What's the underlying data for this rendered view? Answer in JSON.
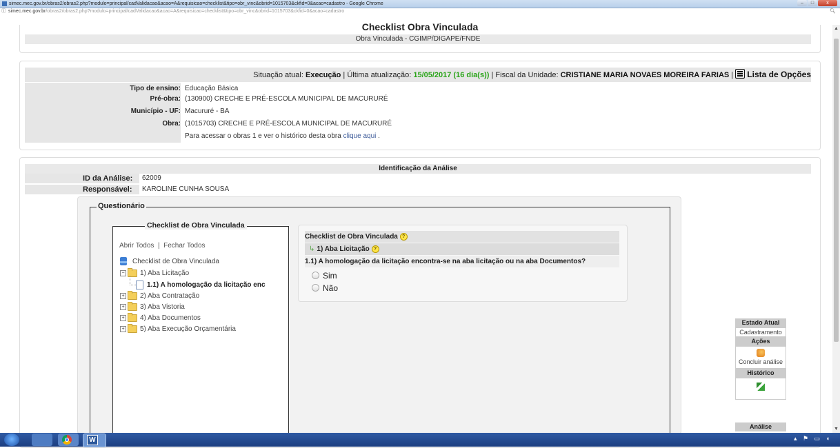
{
  "browser": {
    "title": "simec.mec.gov.br/obras2/obras2.php?modulo=principal/cadValidacao&acao=A&requisicao=checklist&tipo=obr_vinc&obrid=1015703&ckfid=0&acao=cadastro - Google Chrome",
    "url_host": "simec.mec.gov.br",
    "url_path": "/obras2/obras2.php?modulo=principal/cadValidacao&acao=A&requisicao=checklist&tipo=obr_vinc&obrid=1015703&ckfid=0&acao=cadastro",
    "controls": {
      "minimize": "–",
      "maximize": "□",
      "close": "x"
    }
  },
  "page": {
    "title": "Checklist Obra Vinculada",
    "subtitle": "Obra Vinculada - CGIMP/DIGAPE/FNDE"
  },
  "status": {
    "situacao_label": "Situação atual:",
    "situacao_value": "Execução",
    "atualizacao_label": "Última atualização:",
    "atualizacao_value": "15/05/2017 (16 dia(s))",
    "fiscal_label": "Fiscal da Unidade:",
    "fiscal_value": "CRISTIANE MARIA NOVAES MOREIRA FARIAS",
    "opcoes_label": "Lista de Opções"
  },
  "obra_info": [
    {
      "label": "Tipo de ensino:",
      "value": "Educação Básica"
    },
    {
      "label": "Pré-obra:",
      "value": "(130900) CRECHE E PRÉ-ESCOLA MUNICIPAL DE MACURURÉ"
    },
    {
      "label": "Município - UF:",
      "value": "Macururé - BA"
    },
    {
      "label": "Obra:",
      "value": "(1015703) CRECHE E PRÉ-ESCOLA MUNICIPAL DE MACURURÉ"
    }
  ],
  "historico_text": "Para acessar o obras 1 e ver o histórico desta obra ",
  "historico_link": "clique aqui",
  "analise": {
    "title": "Identificação da Análise",
    "id_label": "ID da Análise:",
    "id_value": "62009",
    "resp_label": "Responsável:",
    "resp_value": "KAROLINE CUNHA SOUSA"
  },
  "questionario": {
    "legend": "Questionário",
    "checklist_legend": "Checklist de Obra Vinculada",
    "abrir_todos": "Abrir Todos",
    "separator": "|",
    "fechar_todos": "Fechar Todos",
    "tree_root": "Checklist de Obra Vinculada",
    "tree_items": [
      {
        "label": "1) Aba Licitação",
        "expanded": true
      },
      {
        "label": "2) Aba Contratação",
        "expanded": false
      },
      {
        "label": "3) Aba Vistoria",
        "expanded": false
      },
      {
        "label": "4) Aba Documentos",
        "expanded": false
      },
      {
        "label": "5) Aba Execução Orçamentária",
        "expanded": false
      }
    ],
    "tree_child": "1.1) A homologação da licitação enc"
  },
  "question": {
    "header": "Checklist de Obra Vinculada",
    "section": "1) Aba Licitação",
    "text": "1.1) A homologação da licitação encontra-se na aba licitação ou na aba Documentos?",
    "options": [
      "Sim",
      "Não"
    ]
  },
  "side_panel": {
    "estado_atual": "Estado Atual",
    "estado_value": "Cadastramento",
    "acoes": "Ações",
    "concluir": "Concluir análise",
    "historico": "Histórico",
    "analise": "Análise"
  },
  "colors": {
    "green": "#2ba51a",
    "link": "#3b5998",
    "header_gray": "#e6e6e6"
  }
}
